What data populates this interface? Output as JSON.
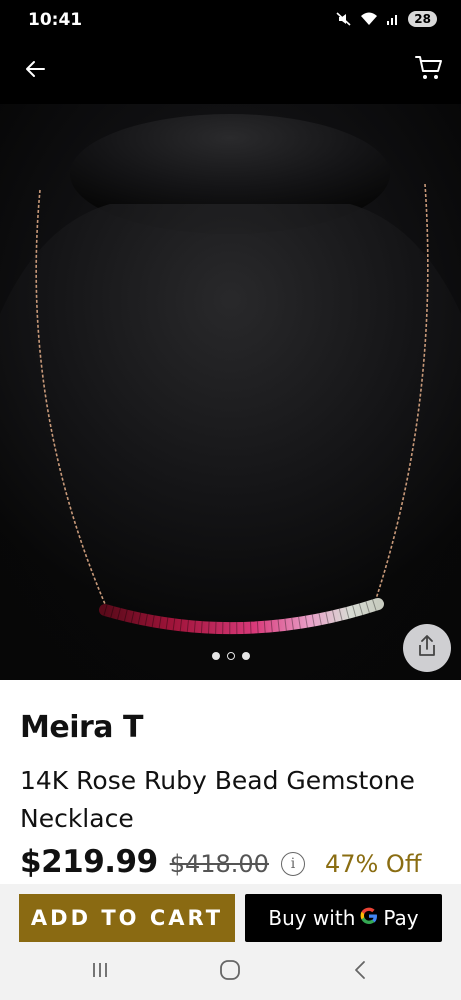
{
  "status_bar": {
    "time": "10:41",
    "battery": "28",
    "icons": [
      "mute-icon",
      "wifi-icon",
      "signal-icon"
    ]
  },
  "header": {
    "back_icon": "arrow-left-icon",
    "cart_icon": "shopping-cart-icon"
  },
  "gallery": {
    "image_count": 3,
    "active_index": 1,
    "share_icon": "share-icon"
  },
  "product": {
    "brand": "Meira T",
    "title": "14K Rose Ruby Bead Gemstone Necklace",
    "price": "$219.99",
    "original_price": "$418.00",
    "info_symbol": "i",
    "discount": "47% Off"
  },
  "actions": {
    "add_to_cart_label": "ADD TO CART",
    "gpay_prefix": "Buy with",
    "gpay_suffix": "Pay"
  },
  "nav": {
    "icons": [
      "recent-apps-icon",
      "home-icon",
      "back-icon"
    ]
  },
  "colors": {
    "accent_gold": "#8a6a12",
    "discount_text": "#8a6d12",
    "background_dark": "#000000",
    "gpay_button": "#000000"
  }
}
